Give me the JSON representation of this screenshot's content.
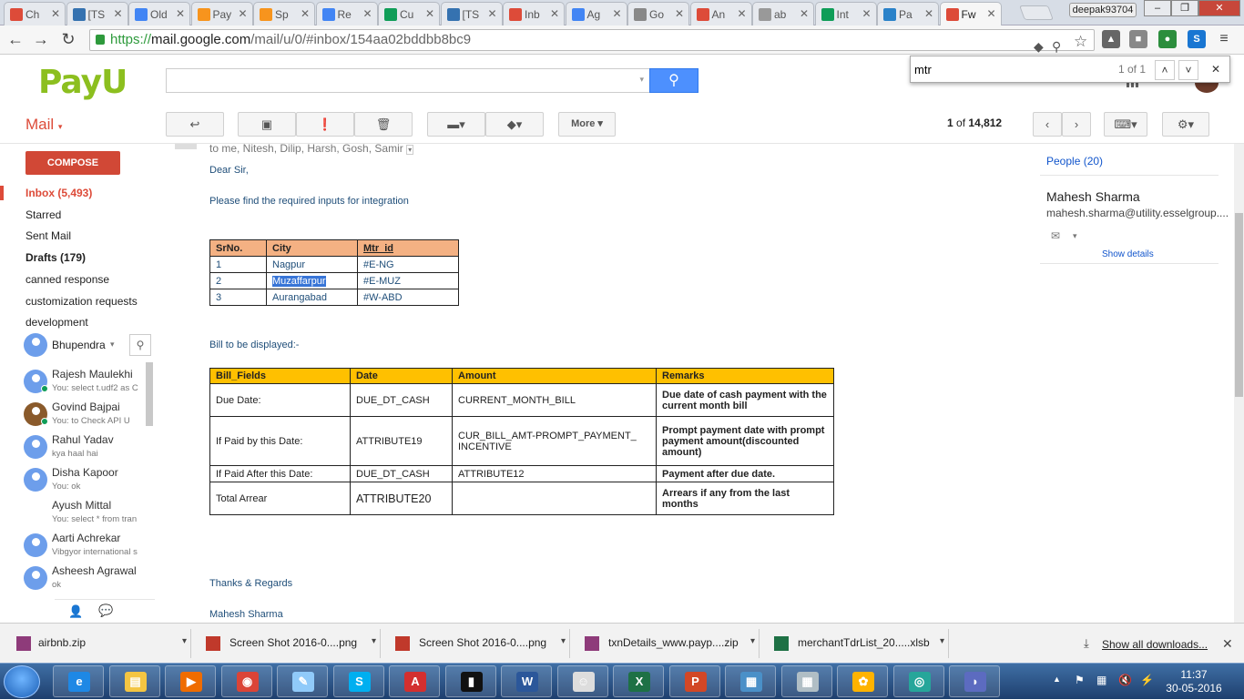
{
  "browser": {
    "tabs": [
      {
        "label": "Ch",
        "fav": "gmail-icon",
        "color": "#dd4b39"
      },
      {
        "label": "[TS",
        "fav": "jira-icon",
        "color": "#3572b0"
      },
      {
        "label": "Old",
        "fav": "doc-icon",
        "color": "#4285f4"
      },
      {
        "label": "Pay",
        "fav": "payu-icon",
        "color": "#f7941d"
      },
      {
        "label": "Sp",
        "fav": "payu-icon",
        "color": "#f7941d"
      },
      {
        "label": "Re",
        "fav": "doc-icon",
        "color": "#4285f4"
      },
      {
        "label": "Cu",
        "fav": "sheet-icon",
        "color": "#0f9d58"
      },
      {
        "label": "[TS",
        "fav": "jira-icon",
        "color": "#3572b0"
      },
      {
        "label": "Inb",
        "fav": "gmail-icon",
        "color": "#dd4b39"
      },
      {
        "label": "Ag",
        "fav": "doc-icon",
        "color": "#4285f4"
      },
      {
        "label": "Go",
        "fav": "google-icon",
        "color": "#888888"
      },
      {
        "label": "An",
        "fav": "gmail-icon",
        "color": "#dd4b39"
      },
      {
        "label": "ab",
        "fav": "file-icon",
        "color": "#999999"
      },
      {
        "label": "Int",
        "fav": "sheet-icon",
        "color": "#0f9d58"
      },
      {
        "label": "Pa",
        "fav": "payu-icon",
        "color": "#2a82c9"
      },
      {
        "label": "Fw",
        "fav": "gmail-icon",
        "color": "#dd4b39"
      }
    ],
    "user_badge": "deepak93704",
    "url_scheme": "https://",
    "url_host": "mail.google.com",
    "url_rest": "/mail/u/0/#inbox/154aa02bddbb8bc9"
  },
  "find": {
    "query": "mtr",
    "count": "1 of 1"
  },
  "gmail": {
    "logo_main": "Pay",
    "logo_u": "U",
    "mail_label": "Mail",
    "more_label": "More",
    "pager_pos": "1",
    "pager_of": "of",
    "pager_total": "14,812",
    "account_name": "Bhupendra",
    "compose": "COMPOSE",
    "nav": [
      {
        "label": "Inbox (5,493)"
      },
      {
        "label": "Starred"
      },
      {
        "label": "Sent Mail"
      },
      {
        "label": "Drafts (179)"
      },
      {
        "label": "canned response"
      },
      {
        "label": "customization requests"
      },
      {
        "label": "development"
      }
    ],
    "chat_user": "Bhupendra",
    "contacts": [
      {
        "name": "Rajesh Maulekhi",
        "msg": "You: select t.udf2 as C"
      },
      {
        "name": "Govind Bajpai",
        "msg": "You: to Check API   U"
      },
      {
        "name": "Rahul Yadav",
        "msg": "kya haal hai"
      },
      {
        "name": "Disha Kapoor",
        "msg": "You: ok"
      },
      {
        "name": "Ayush Mittal",
        "msg": "You: select * from tran"
      },
      {
        "name": "Aarti Achrekar",
        "msg": "Vibgyor international s"
      },
      {
        "name": "Asheesh Agrawal",
        "msg": "ok"
      }
    ]
  },
  "email": {
    "recipients": "to me, Nitesh, Dilip, Harsh, Gosh, Samir",
    "greeting": "Dear Sir,",
    "intro": "Please find the required inputs for integration",
    "table1": {
      "headers": [
        "SrNo.",
        "City",
        "Mtr_id"
      ],
      "rows": [
        [
          "1",
          "Nagpur",
          "#E-NG"
        ],
        [
          "2",
          "Muzaffarpur",
          "#E-MUZ"
        ],
        [
          "3",
          "Aurangabad",
          "#W-ABD"
        ]
      ]
    },
    "bill_intro": "Bill to be displayed:-",
    "table2": {
      "headers": [
        "Bill_Fields",
        "Date",
        "Amount",
        "Remarks"
      ],
      "rows": [
        [
          "Due Date:",
          "DUE_DT_CASH",
          "CURRENT_MONTH_BILL",
          "Due date of cash payment with the current month bill"
        ],
        [
          "If Paid by this Date:",
          "ATTRIBUTE19",
          "CUR_BILL_AMT-PROMPT_PAYMENT_ INCENTIVE",
          "Prompt payment date with prompt payment amount(discounted amount)"
        ],
        [
          "If Paid After this Date:",
          "DUE_DT_CASH",
          "ATTRIBUTE12",
          "Payment after due date."
        ],
        [
          "Total Arrear",
          "ATTRIBUTE20",
          "",
          "Arrears if any from the last months"
        ]
      ]
    },
    "thanks": "Thanks & Regards",
    "signature": "Mahesh Sharma"
  },
  "people": {
    "header": "People (20)",
    "name": "Mahesh Sharma",
    "email": "mahesh.sharma@utility.esselgroup....",
    "show_details": "Show details"
  },
  "downloads": {
    "items": [
      {
        "name": "airbnb.zip",
        "icon": "zip-icon"
      },
      {
        "name": "Screen Shot 2016-0....png",
        "icon": "png-icon"
      },
      {
        "name": "Screen Shot 2016-0....png",
        "icon": "png-icon"
      },
      {
        "name": "txnDetails_www.payp....zip",
        "icon": "zip-icon"
      },
      {
        "name": "merchantTdrList_20.....xlsb",
        "icon": "excel-icon"
      }
    ],
    "show_all": "Show all downloads..."
  },
  "taskbar": {
    "time": "11:37",
    "date": "30-05-2016"
  }
}
